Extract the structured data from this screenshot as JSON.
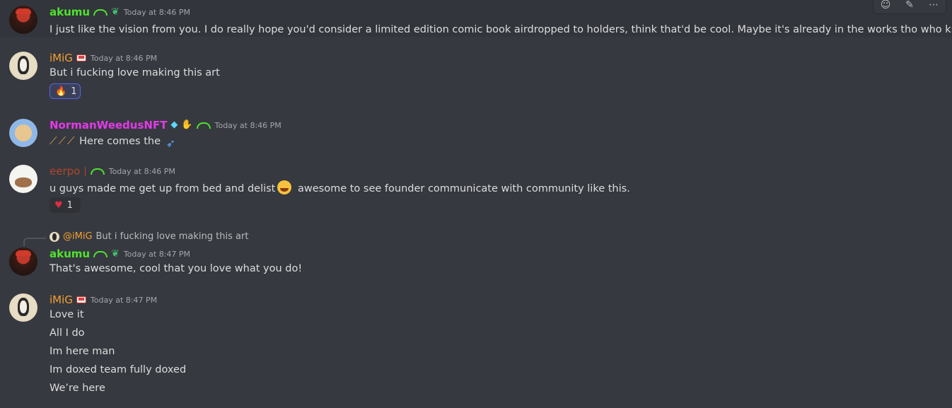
{
  "messages": [
    {
      "author": "akumu",
      "timestamp": "Today at 8:46 PM",
      "lines": [
        "I just like the vision from you. I do really hope you'd consider a limited edition comic book airdropped to holders, think that'd be cool.  Maybe it's already in the works tho who knows"
      ]
    },
    {
      "author": "iMiG",
      "timestamp": "Today at 8:46 PM",
      "lines": [
        "But i fucking love making this art"
      ],
      "reaction": {
        "emoji": "fire",
        "count": "1"
      }
    },
    {
      "author": "NormanWeedusNFT",
      "timestamp": "Today at 8:46 PM",
      "lines": [
        "Here comes the"
      ]
    },
    {
      "author": "eerpo",
      "timestamp": "Today at 8:46 PM",
      "lines": [
        "u guys made me get up from bed and delist",
        "awesome to see founder communicate with community like this."
      ],
      "reaction": {
        "emoji": "heart",
        "count": "1"
      }
    },
    {
      "reply": {
        "mention": "@iMiG",
        "text": "But i fucking love making this art"
      },
      "author": "akumu",
      "timestamp": "Today at 8:47 PM",
      "lines": [
        "That's awesome, cool that you love what you do!"
      ]
    },
    {
      "author": "iMiG",
      "timestamp": "Today at 8:47 PM",
      "lines": [
        "Love it",
        "All I do",
        "Im here man",
        "Im doxed team fully doxed",
        "We’re here"
      ]
    }
  ],
  "icons": {
    "toolbar": [
      "add-reaction-icon",
      "edit-icon",
      "more-options-icon"
    ]
  },
  "colors": {
    "background": "#36393f",
    "akumu": "#4fe32e",
    "imig": "#f5a033",
    "norman": "#e33ae8",
    "eerpo": "#b0472c",
    "reaction_active_border": "#5865f2"
  }
}
